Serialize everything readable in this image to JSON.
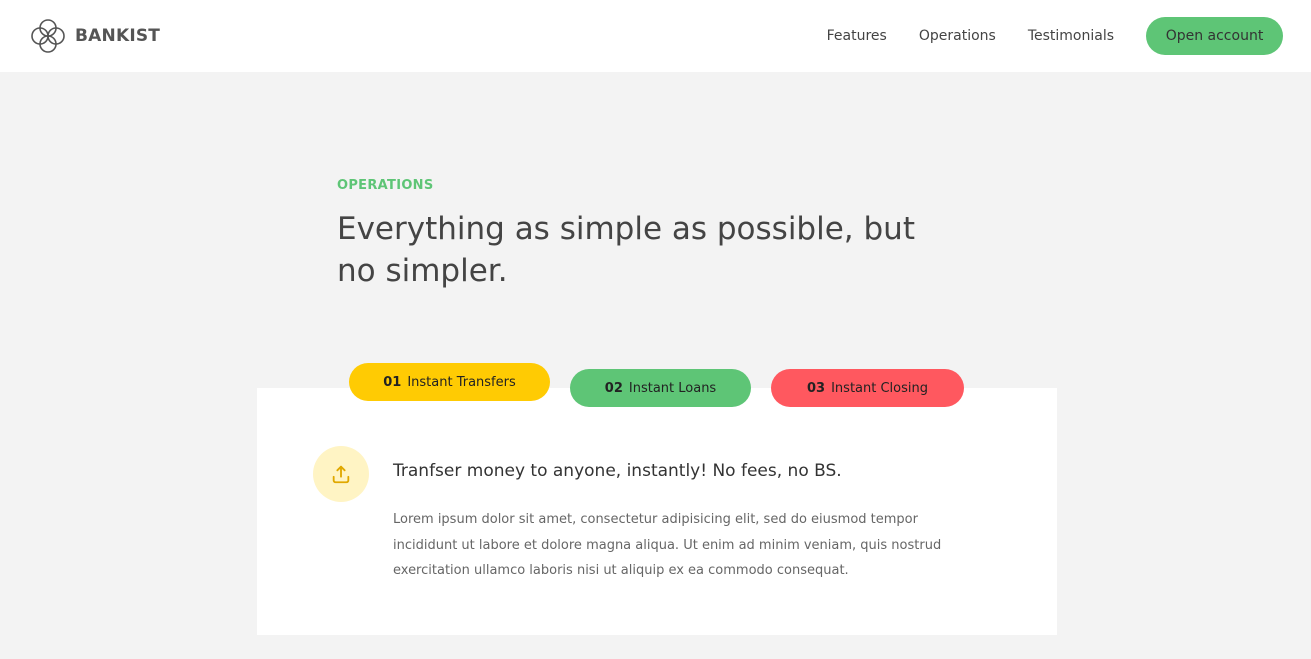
{
  "nav": {
    "brand": "BANKIST",
    "links": [
      "Features",
      "Operations",
      "Testimonials"
    ],
    "cta": "Open account"
  },
  "section": {
    "label": "OPERATIONS",
    "title": "Everything as simple as possible, but no simpler."
  },
  "operations": {
    "tabs": [
      {
        "num": "01",
        "label": "Instant Transfers",
        "color": "#ffcb03"
      },
      {
        "num": "02",
        "label": "Instant Loans",
        "color": "#5ec576"
      },
      {
        "num": "03",
        "label": "Instant Closing",
        "color": "#ff585f"
      }
    ],
    "content": {
      "icon": "upload-icon",
      "title": "Tranfser money to anyone, instantly! No fees, no BS.",
      "text": "Lorem ipsum dolor sit amet, consectetur adipisicing elit, sed do eiusmod tempor incididunt ut labore et dolore magna aliqua. Ut enim ad minim veniam, quis nostrud exercitation ullamco laboris nisi ut aliquip ex ea commodo consequat."
    }
  },
  "colors": {
    "accent_green": "#5ec576",
    "accent_yellow": "#ffcb03",
    "accent_red": "#ff585f",
    "background": "#f3f3f3"
  }
}
